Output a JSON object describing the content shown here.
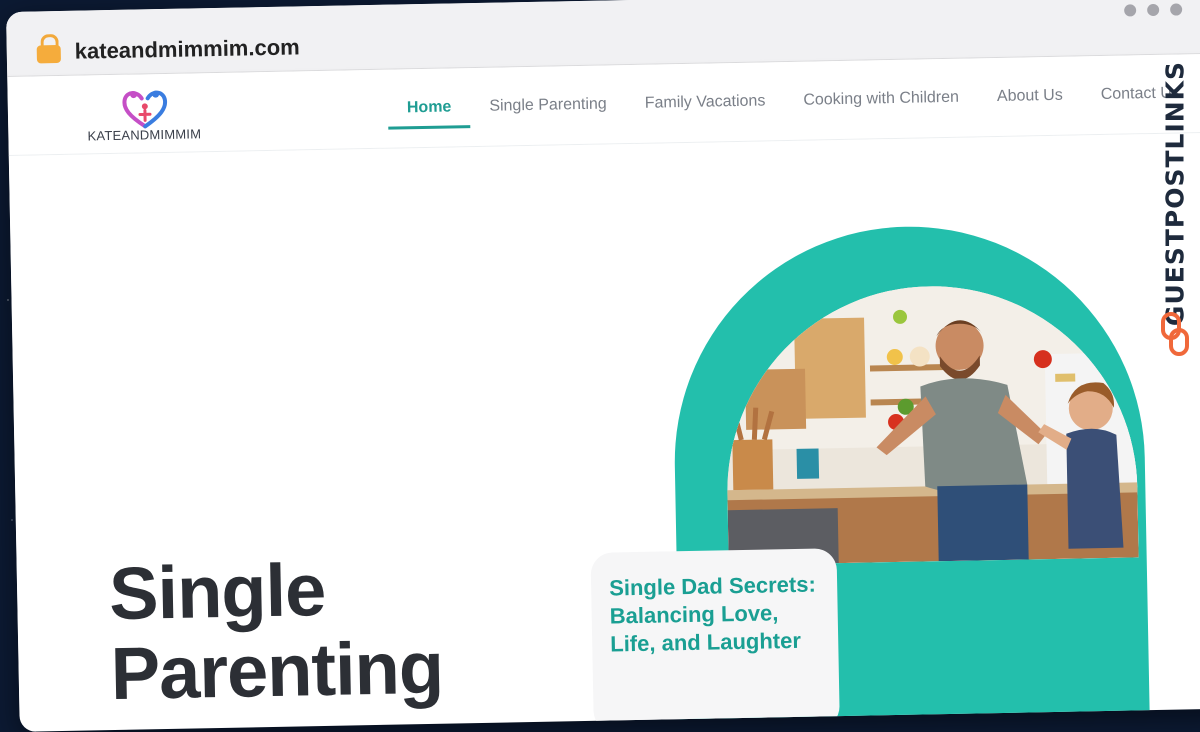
{
  "browser": {
    "url": "kateandmimmim.com"
  },
  "site": {
    "logo_text": "KATEANDMIMMIM",
    "nav": [
      {
        "label": "Home",
        "active": true
      },
      {
        "label": "Single Parenting"
      },
      {
        "label": "Family Vacations"
      },
      {
        "label": "Cooking with Children"
      },
      {
        "label": "About Us"
      },
      {
        "label": "Contact Us"
      }
    ],
    "accent_color": "#1f9d93"
  },
  "hero": {
    "title_line1": "Single",
    "title_line2": "Parenting",
    "card_title": "Single Dad Secrets: Balancing Love, Life, and Laughter"
  },
  "watermark": {
    "text": "GUESTPOSTLINKS"
  }
}
